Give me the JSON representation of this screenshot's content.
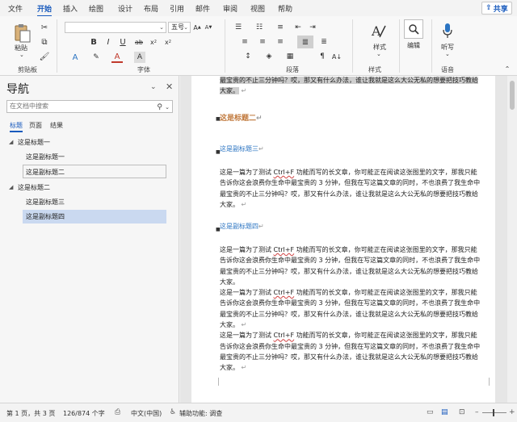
{
  "menu": {
    "tabs": [
      "文件",
      "开始",
      "插入",
      "绘图",
      "设计",
      "布局",
      "引用",
      "邮件",
      "审阅",
      "视图",
      "帮助"
    ],
    "active_tab": "开始",
    "share_label": "共享"
  },
  "ribbon": {
    "paste_label": "粘贴",
    "font_size": "五号",
    "groups": {
      "clipboard": "剪贴板",
      "font": "字体",
      "paragraph": "段落",
      "styles": "样式",
      "voice": "语音"
    },
    "styles_label": "样式",
    "edit_label": "编辑",
    "dictate_label": "听写",
    "font_buttons": [
      "B",
      "I",
      "U",
      "A"
    ],
    "accent_color": "#185abd"
  },
  "nav": {
    "title": "导航",
    "search_placeholder": "在文档中搜索",
    "tabs": [
      "标题",
      "页面",
      "结果"
    ],
    "active_tab": "标题",
    "headings": [
      {
        "label": "这是标题一",
        "level": 1,
        "expanded": true
      },
      {
        "label": "这是副标题一",
        "level": 2,
        "selected": false
      },
      {
        "label": "这是副标题二",
        "level": 2,
        "selected": false
      },
      {
        "label": "这是标题二",
        "level": 1,
        "expanded": true
      },
      {
        "label": "这是副标题三",
        "level": 2,
        "selected": false
      },
      {
        "label": "这是副标题四",
        "level": 2,
        "selected": true
      }
    ]
  },
  "document": {
    "top_lines": [
      "最宝贵的不止三分钟吗？哎，那又有什么办法，谁让我就是这么大公无私的想要把技巧教给",
      "大家。"
    ],
    "heading_title2": "这是标题二",
    "subheading3": "这是副标题三",
    "subheading4": "这是副标题四",
    "para_lines": [
      "这是一篇为了测试 Ctrl+F 功能而写的长文章，你可能正在阅读这张图里的文字，那我只能",
      "告诉你这会浪费你生命中最宝贵的 3 分钟，但我在写这篇文章的同时，不也浪费了我生命中",
      "最宝贵的不止三分钟吗？哎，那又有什么办法，谁让我就是这么大公无私的想要把技巧教给",
      "大家。"
    ],
    "ctrlf": "Ctrl+F"
  },
  "status": {
    "page": "第 1 页，共 3 页",
    "words": "126/874 个字",
    "language": "中文(中国)",
    "accessibility": "辅助功能: 调查"
  }
}
